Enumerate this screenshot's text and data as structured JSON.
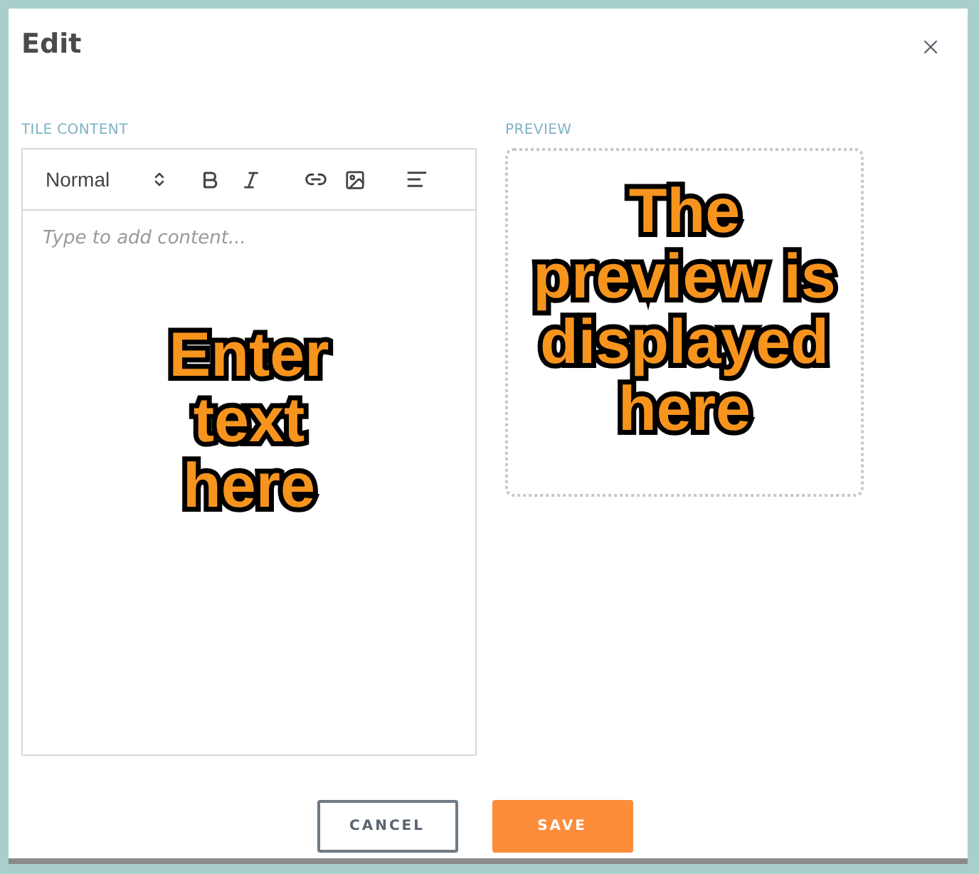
{
  "dialog": {
    "title": "Edit"
  },
  "editor": {
    "label": "TILE CONTENT",
    "format": "Normal",
    "placeholder": "Type to add content...",
    "annotation": [
      "Enter",
      "text",
      "here"
    ]
  },
  "preview": {
    "label": "PREVIEW",
    "annotation": [
      "The",
      "preview is",
      "displayed",
      "here"
    ]
  },
  "buttons": [
    {
      "kind": "secondary",
      "label": "CANCEL"
    },
    {
      "kind": "primary",
      "label": "SAVE"
    }
  ]
}
